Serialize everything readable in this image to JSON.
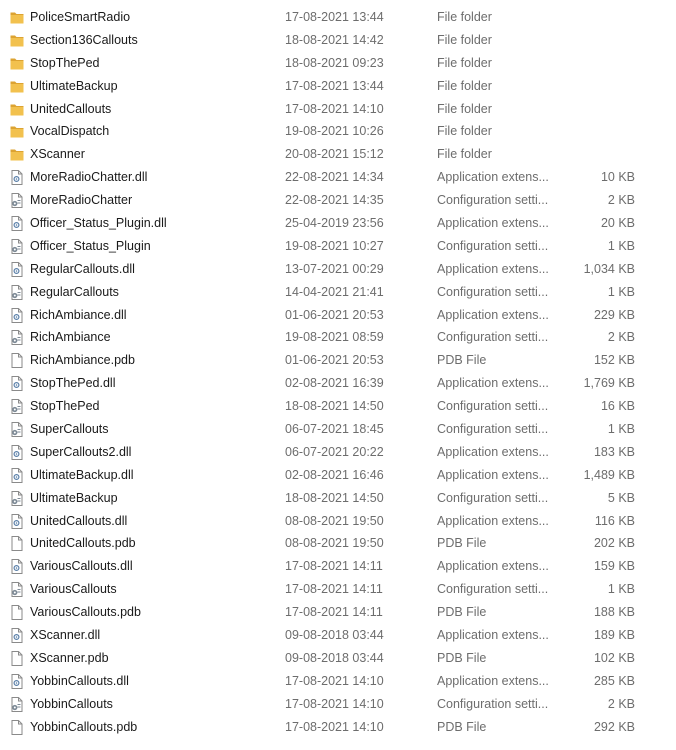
{
  "colors": {
    "folder": "#f2c14e",
    "folder_dark": "#dca332",
    "text": "#1a1a1a",
    "meta_text": "#6d6d6d"
  },
  "files": [
    {
      "name": "PoliceSmartRadio",
      "date": "17-08-2021 13:44",
      "type": "File folder",
      "size": "",
      "icon": "folder-icon"
    },
    {
      "name": "Section136Callouts",
      "date": "18-08-2021 14:42",
      "type": "File folder",
      "size": "",
      "icon": "folder-icon"
    },
    {
      "name": "StopThePed",
      "date": "18-08-2021 09:23",
      "type": "File folder",
      "size": "",
      "icon": "folder-icon"
    },
    {
      "name": "UltimateBackup",
      "date": "17-08-2021 13:44",
      "type": "File folder",
      "size": "",
      "icon": "folder-icon"
    },
    {
      "name": "UnitedCallouts",
      "date": "17-08-2021 14:10",
      "type": "File folder",
      "size": "",
      "icon": "folder-icon"
    },
    {
      "name": "VocalDispatch",
      "date": "19-08-2021 10:26",
      "type": "File folder",
      "size": "",
      "icon": "folder-icon"
    },
    {
      "name": "XScanner",
      "date": "20-08-2021 15:12",
      "type": "File folder",
      "size": "",
      "icon": "folder-icon"
    },
    {
      "name": "MoreRadioChatter.dll",
      "date": "22-08-2021 14:34",
      "type": "Application extens...",
      "size": "10 KB",
      "icon": "dll-icon"
    },
    {
      "name": "MoreRadioChatter",
      "date": "22-08-2021 14:35",
      "type": "Configuration setti...",
      "size": "2 KB",
      "icon": "config-icon"
    },
    {
      "name": "Officer_Status_Plugin.dll",
      "date": "25-04-2019 23:56",
      "type": "Application extens...",
      "size": "20 KB",
      "icon": "dll-icon"
    },
    {
      "name": "Officer_Status_Plugin",
      "date": "19-08-2021 10:27",
      "type": "Configuration setti...",
      "size": "1 KB",
      "icon": "config-icon"
    },
    {
      "name": "RegularCallouts.dll",
      "date": "13-07-2021 00:29",
      "type": "Application extens...",
      "size": "1,034 KB",
      "icon": "dll-icon"
    },
    {
      "name": "RegularCallouts",
      "date": "14-04-2021 21:41",
      "type": "Configuration setti...",
      "size": "1 KB",
      "icon": "config-icon"
    },
    {
      "name": "RichAmbiance.dll",
      "date": "01-06-2021 20:53",
      "type": "Application extens...",
      "size": "229 KB",
      "icon": "dll-icon"
    },
    {
      "name": "RichAmbiance",
      "date": "19-08-2021 08:59",
      "type": "Configuration setti...",
      "size": "2 KB",
      "icon": "config-icon"
    },
    {
      "name": "RichAmbiance.pdb",
      "date": "01-06-2021 20:53",
      "type": "PDB File",
      "size": "152 KB",
      "icon": "blank-file-icon"
    },
    {
      "name": "StopThePed.dll",
      "date": "02-08-2021 16:39",
      "type": "Application extens...",
      "size": "1,769 KB",
      "icon": "dll-icon"
    },
    {
      "name": "StopThePed",
      "date": "18-08-2021 14:50",
      "type": "Configuration setti...",
      "size": "16 KB",
      "icon": "config-icon"
    },
    {
      "name": "SuperCallouts",
      "date": "06-07-2021 18:45",
      "type": "Configuration setti...",
      "size": "1 KB",
      "icon": "config-icon"
    },
    {
      "name": "SuperCallouts2.dll",
      "date": "06-07-2021 20:22",
      "type": "Application extens...",
      "size": "183 KB",
      "icon": "dll-icon"
    },
    {
      "name": "UltimateBackup.dll",
      "date": "02-08-2021 16:46",
      "type": "Application extens...",
      "size": "1,489 KB",
      "icon": "dll-icon"
    },
    {
      "name": "UltimateBackup",
      "date": "18-08-2021 14:50",
      "type": "Configuration setti...",
      "size": "5 KB",
      "icon": "config-icon"
    },
    {
      "name": "UnitedCallouts.dll",
      "date": "08-08-2021 19:50",
      "type": "Application extens...",
      "size": "116 KB",
      "icon": "dll-icon"
    },
    {
      "name": "UnitedCallouts.pdb",
      "date": "08-08-2021 19:50",
      "type": "PDB File",
      "size": "202 KB",
      "icon": "blank-file-icon"
    },
    {
      "name": "VariousCallouts.dll",
      "date": "17-08-2021 14:11",
      "type": "Application extens...",
      "size": "159 KB",
      "icon": "dll-icon"
    },
    {
      "name": "VariousCallouts",
      "date": "17-08-2021 14:11",
      "type": "Configuration setti...",
      "size": "1 KB",
      "icon": "config-icon"
    },
    {
      "name": "VariousCallouts.pdb",
      "date": "17-08-2021 14:11",
      "type": "PDB File",
      "size": "188 KB",
      "icon": "blank-file-icon"
    },
    {
      "name": "XScanner.dll",
      "date": "09-08-2018 03:44",
      "type": "Application extens...",
      "size": "189 KB",
      "icon": "dll-icon"
    },
    {
      "name": "XScanner.pdb",
      "date": "09-08-2018 03:44",
      "type": "PDB File",
      "size": "102 KB",
      "icon": "blank-file-icon"
    },
    {
      "name": "YobbinCallouts.dll",
      "date": "17-08-2021 14:10",
      "type": "Application extens...",
      "size": "285 KB",
      "icon": "dll-icon"
    },
    {
      "name": "YobbinCallouts",
      "date": "17-08-2021 14:10",
      "type": "Configuration setti...",
      "size": "2 KB",
      "icon": "config-icon"
    },
    {
      "name": "YobbinCallouts.pdb",
      "date": "17-08-2021 14:10",
      "type": "PDB File",
      "size": "292 KB",
      "icon": "blank-file-icon"
    }
  ]
}
